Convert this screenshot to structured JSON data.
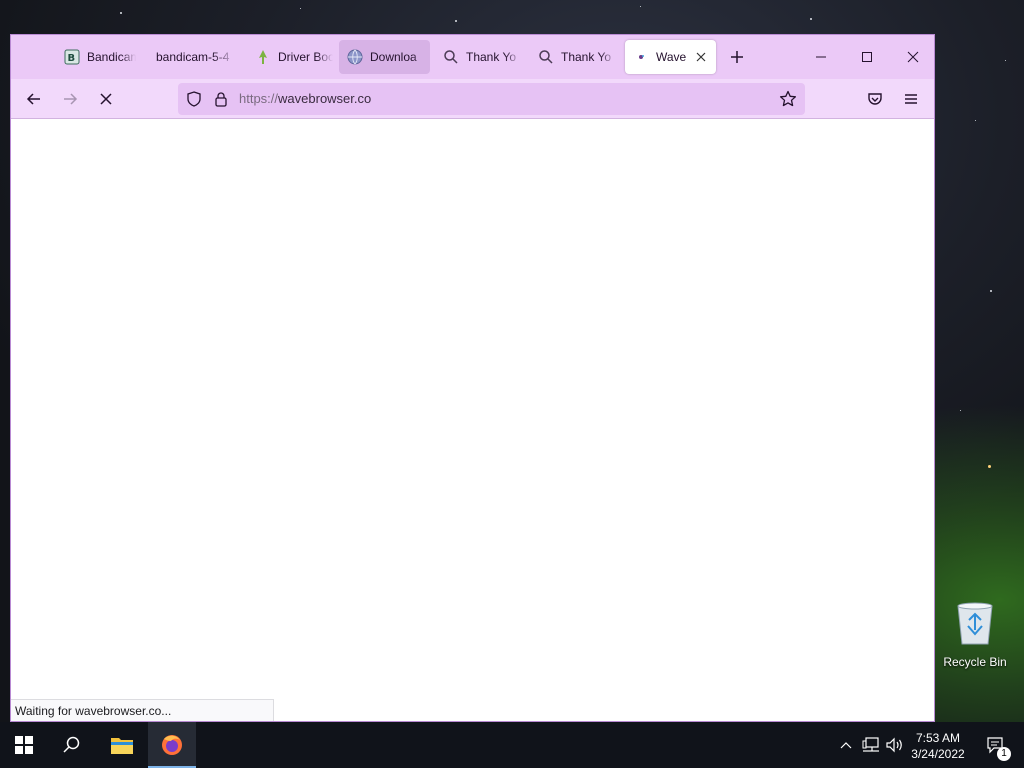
{
  "browser": {
    "tabs": [
      {
        "label": "Bandicam",
        "favicon": "bandicam-icon"
      },
      {
        "label": "bandicam-5-4",
        "favicon": "none"
      },
      {
        "label": "Driver Boo",
        "favicon": "driver-booster-icon"
      },
      {
        "label": "Downloa",
        "favicon": "globe-icon"
      },
      {
        "label": "Thank Yo",
        "favicon": "search-icon"
      },
      {
        "label": "Thank Yo",
        "favicon": "search-icon"
      },
      {
        "label": "Wave",
        "favicon": "wave-icon"
      }
    ],
    "url": {
      "protocol": "https://",
      "host": "wavebrowser.co"
    },
    "status_text": "Waiting for wavebrowser.co..."
  },
  "desktop": {
    "recycle_bin_label": "Recycle Bin"
  },
  "taskbar": {
    "time": "7:53 AM",
    "date": "3/24/2022",
    "notification_count": "1"
  },
  "colors": {
    "tabbar_bg": "#ebc9f7",
    "navbar_bg": "#f2d9fb",
    "urlbar_bg": "#e6c2f4",
    "taskbar_bg": "#10131a"
  }
}
